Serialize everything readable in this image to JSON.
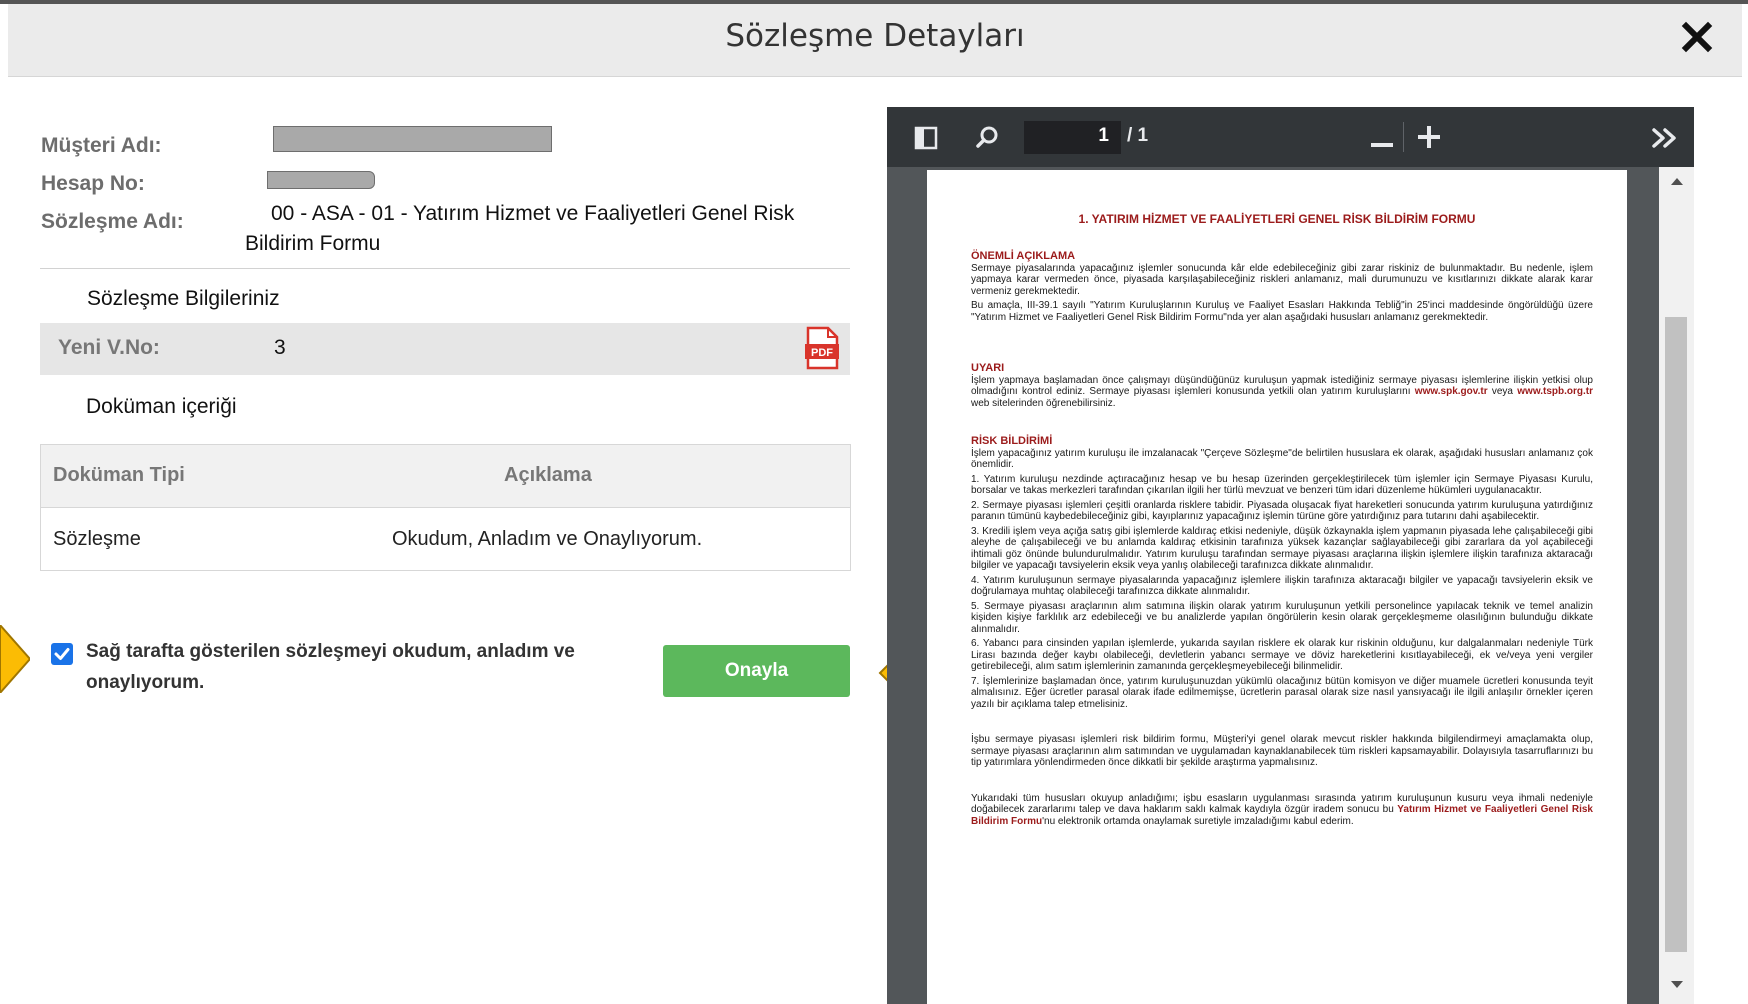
{
  "modal": {
    "title": "Sözleşme Detayları"
  },
  "contract": {
    "customer_label": "Müşteri Adı:",
    "account_label": "Hesap No:",
    "contract_name_label": "Sözleşme Adı:",
    "contract_name_line1": "00 - ASA - 01 - Yatırım Hizmet ve Faaliyetleri Genel Risk",
    "contract_name_line2": "Bildirim Formu"
  },
  "info": {
    "section_title": "Sözleşme Bilgileriniz",
    "version_label": "Yeni V.No:",
    "version_value": "3"
  },
  "document": {
    "section_title": "Doküman içeriği",
    "columns": [
      "Doküman Tipi",
      "Açıklama"
    ],
    "rows": [
      {
        "type": "Sözleşme",
        "description": "Okudum, Anladım ve Onaylıyorum."
      }
    ]
  },
  "consent": {
    "text": "Sağ tarafta gösterilen sözleşmeyi okudum, anladım ve onaylıyorum.",
    "checked": true
  },
  "approve_button": {
    "label": "Onayla",
    "color": "#5cb85c"
  },
  "highlight_color": "#fbbc04",
  "pdf_viewer": {
    "page_current": "1",
    "page_total": "/ 1",
    "doc": {
      "title": "1. YATIRIM HİZMET VE FAALİYETLERİ GENEL RİSK BİLDİRİM FORMU",
      "s1_head": "ÖNEMLİ AÇIKLAMA",
      "s1_p1": "Sermaye piyasalarında yapacağınız işlemler sonucunda kâr elde edebileceğiniz gibi zarar riskiniz de bulunmaktadır. Bu nedenle, işlem yapmaya karar vermeden önce, piyasada karşılaşabileceğiniz riskleri anlamanız, mali durumunuzu ve kısıtlarınızı dikkate alarak karar vermeniz gerekmektedir.",
      "s1_p2": "Bu amaçla, III-39.1 sayılı \"Yatırım Kuruluşlarının Kuruluş ve Faaliyet Esasları Hakkında Tebliğ\"in 25'inci maddesinde öngörüldüğü üzere \"Yatırım Hizmet ve Faaliyetleri Genel Risk Bildirim Formu\"nda yer alan aşağıdaki hususları anlamanız gerekmektedir.",
      "s2_head": "UYARI",
      "s2_p1a": "İşlem yapmaya başlamadan önce çalışmayı düşündüğünüz kuruluşun yapmak istediğiniz sermaye piyasası işlemlerine ilişkin yetkisi olup olmadığını kontrol ediniz. Sermaye piyasası işlemleri konusunda yetkili olan yatırım kuruluşlarını",
      "s2_link1": "www.spk.gov.tr",
      "s2_p1b": "veya",
      "s2_link2": "www.tspb.org.tr",
      "s2_p1c": "web sitelerinden öğrenebilirsiniz.",
      "s3_head": "RİSK BİLDİRİMİ",
      "s3_intro": "İşlem yapacağınız yatırım kuruluşu ile imzalanacak \"Çerçeve Sözleşme\"de belirtilen hususlara ek olarak, aşağıdaki hususları anlamanız çok önemlidir.",
      "s3_i1": "1. Yatırım kuruluşu nezdinde açtıracağınız hesap ve bu hesap üzerinden gerçekleştirilecek tüm işlemler için Sermaye Piyasası Kurulu, borsalar ve takas merkezleri tarafından çıkarılan ilgili her türlü mevzuat ve benzeri tüm idari düzenleme hükümleri uygulanacaktır.",
      "s3_i2": "2. Sermaye piyasası işlemleri çeşitli oranlarda risklere tabidir. Piyasada oluşacak fiyat hareketleri sonucunda yatırım kuruluşuna yatırdığınız paranın tümünü kaybedebileceğiniz gibi, kayıplarınız yapacağınız işlemin türüne göre yatırdığınız para tutarını dahi aşabilecektir.",
      "s3_i3": "3. Kredili işlem veya açığa satış gibi işlemlerde kaldıraç etkisi nedeniyle, düşük özkaynakla işlem yapmanın piyasada lehe çalışabileceği gibi aleyhe de çalışabileceği ve bu anlamda kaldıraç etkisinin tarafınıza yüksek kazançlar sağlayabileceği gibi zararlara da yol açabileceği ihtimali göz önünde bulundurulmalıdır. Yatırım kuruluşu tarafından sermaye piyasası araçlarına ilişkin işlemlere ilişkin tarafınıza aktaracağı bilgiler ve yapacağı tavsiyelerin eksik veya yanlış olabileceği tarafınızca dikkate alınmalıdır.",
      "s3_i4": "4. Yatırım kuruluşunun sermaye piyasalarında yapacağınız işlemlere ilişkin tarafınıza aktaracağı bilgiler ve yapacağı tavsiyelerin eksik ve doğrulamaya muhtaç olabileceği tarafınızca dikkate alınmalıdır.",
      "s3_i5": "5. Sermaye piyasası araçlarının alım satımına ilişkin olarak yatırım kuruluşunun yetkili personelince yapılacak teknik ve temel analizin kişiden kişiye farklılık arz edebileceği ve bu analizlerde yapılan öngörülerin kesin olarak gerçekleşmeme olasılığının bulunduğu dikkate alınmalıdır.",
      "s3_i6": "6. Yabancı para cinsinden yapılan işlemlerde, yukarıda sayılan risklere ek olarak kur riskinin olduğunu, kur dalgalanmaları nedeniyle Türk Lirası bazında değer kaybı olabileceği, devletlerin yabancı sermaye ve döviz hareketlerini kısıtlayabileceği, ek ve/veya yeni vergiler getirebileceği, alım satım işlemlerinin zamanında gerçekleşmeyebileceği bilinmelidir.",
      "s3_i7": "7. İşlemlerinize başlamadan önce, yatırım kuruluşunuzdan yükümlü olacağınız bütün komisyon ve diğer muamele ücretleri konusunda teyit almalısınız. Eğer ücretler parasal olarak ifade edilmemişse, ücretlerin parasal olarak size nasıl yansıyacağı ile ilgili anlaşılır örnekler içeren yazılı bir açıklama talep etmelisiniz.",
      "s4_p1": "İşbu sermaye piyasası işlemleri risk bildirim formu, Müşteri'yi genel olarak mevcut riskler hakkında bilgilendirmeyi amaçlamakta olup, sermaye piyasası araçlarının alım satımından ve uygulamadan kaynaklanabilecek tüm riskleri kapsamayabilir. Dolayısıyla tasarruflarınızı bu tip yatırımlara yönlendirmeden önce dikkatli bir şekilde araştırma yapmalısınız.",
      "s5_a": "Yukarıdaki tüm hususları okuyup anladığımı; işbu esasların uygulanması sırasında yatırım kuruluşunun kusuru veya ihmali nedeniyle doğabilecek zararlarımı talep ve dava haklarım saklı kalmak kaydıyla özgür iradem sonucu bu",
      "s5_link": "Yatırım Hizmet ve Faaliyetleri Genel Risk Bildirim Formu",
      "s5_b": "'nu elektronik ortamda onaylamak suretiyle imzaladığımı kabul ederim."
    }
  }
}
